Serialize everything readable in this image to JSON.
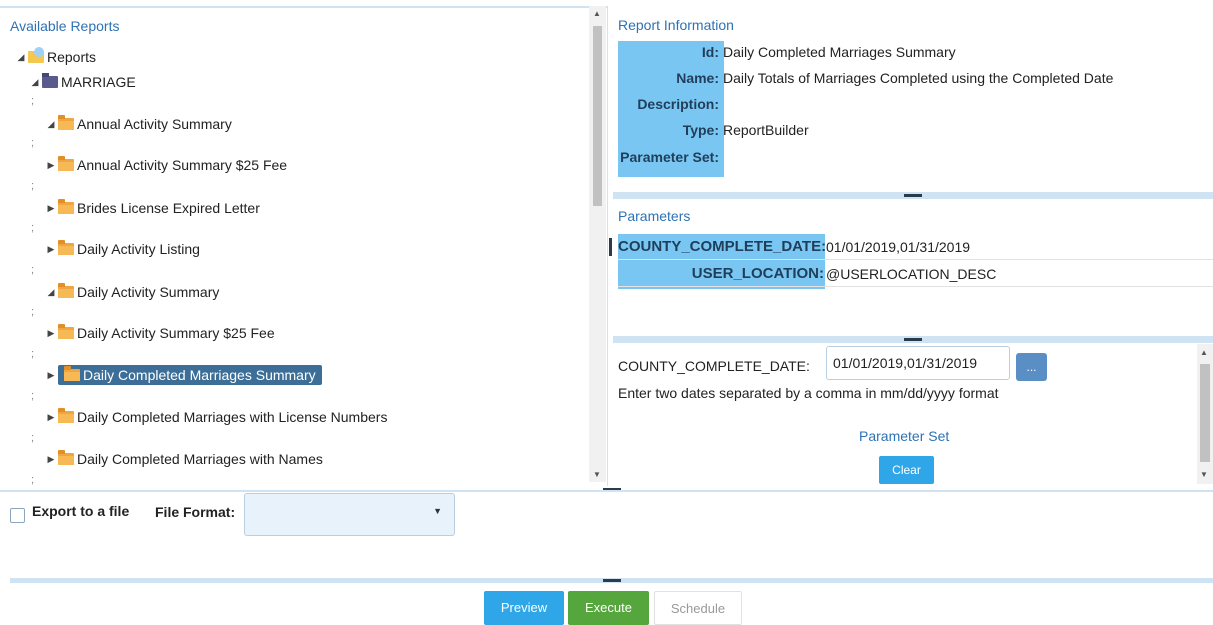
{
  "tree": {
    "title": "Available Reports",
    "root": {
      "label": "Reports"
    },
    "group": {
      "label": "MARRIAGE"
    },
    "separator": ";",
    "items": [
      {
        "label": "Annual Activity Summary",
        "expanded": true
      },
      {
        "label": "Annual Activity Summary $25 Fee",
        "expanded": false
      },
      {
        "label": "Brides License Expired Letter",
        "expanded": false
      },
      {
        "label": "Daily Activity Listing",
        "expanded": false
      },
      {
        "label": "Daily Activity Summary",
        "expanded": true
      },
      {
        "label": "Daily Activity Summary $25 Fee",
        "expanded": false
      },
      {
        "label": "Daily Completed Marriages Summary",
        "expanded": false,
        "selected": true
      },
      {
        "label": "Daily Completed Marriages with License Numbers",
        "expanded": false
      },
      {
        "label": "Daily Completed Marriages with Names",
        "expanded": false
      }
    ]
  },
  "report_info": {
    "title": "Report Information",
    "fields": [
      {
        "key": "Id:",
        "value": "Daily Completed Marriages Summary"
      },
      {
        "key": "Name:",
        "value": "Daily Totals of Marriages Completed using the Completed Date"
      },
      {
        "key": "Description:",
        "value": ""
      },
      {
        "key": "Type:",
        "value": "ReportBuilder"
      },
      {
        "key": "Parameter Set:",
        "value": ""
      }
    ]
  },
  "parameters": {
    "title": "Parameters",
    "rows": [
      {
        "key": "COUNTY_COMPLETE_DATE:",
        "value": "01/01/2019,01/31/2019"
      },
      {
        "key": "USER_LOCATION:",
        "value": "@USERLOCATION_DESC"
      }
    ]
  },
  "param_editor": {
    "label": "COUNTY_COMPLETE_DATE:",
    "value": "01/01/2019,01/31/2019",
    "picker_label": "...",
    "hint": "Enter two dates separated by a comma in mm/dd/yyyy format",
    "param_set_label": "Parameter Set",
    "clear_label": "Clear"
  },
  "export": {
    "checkbox_label": "Export to a file",
    "checked": false,
    "format_label": "File Format:",
    "format_value": ""
  },
  "actions": {
    "preview": "Preview",
    "execute": "Execute",
    "schedule": "Schedule"
  },
  "colors": {
    "accent_blue": "#2fa6e8",
    "execute_green": "#55a63d",
    "label_highlight": "#7ac6f2",
    "selected_row": "#3c6e97",
    "title_blue": "#2d72b5"
  }
}
